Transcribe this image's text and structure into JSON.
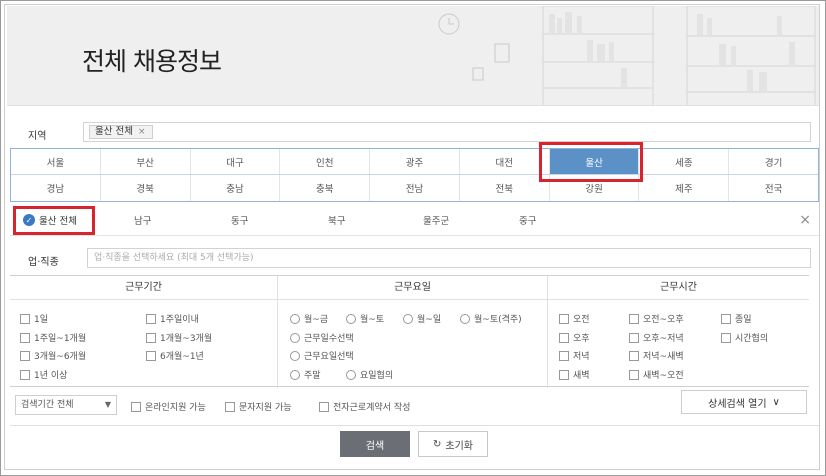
{
  "header": {
    "title": "전체 채용정보"
  },
  "region": {
    "label": "지역",
    "selected_tag": "울산 전체",
    "tag_remove": "×",
    "row1": [
      "서울",
      "부산",
      "대구",
      "인천",
      "광주",
      "대전",
      "울산",
      "세종",
      "경기"
    ],
    "row2": [
      "경남",
      "경북",
      "충남",
      "충북",
      "전남",
      "전북",
      "강원",
      "제주",
      "전국"
    ],
    "active": "울산"
  },
  "district": {
    "all_label": "울산 전체",
    "check_glyph": "✓",
    "items": [
      "남구",
      "동구",
      "북구",
      "울주군",
      "중구"
    ],
    "close_glyph": "×"
  },
  "job": {
    "label": "업·직종",
    "placeholder": "업·직종을 선택하세요 (최대 5개 선택가능)"
  },
  "filters": {
    "period": {
      "title": "근무기간",
      "options": [
        "1일",
        "1주일이내",
        "1주일~1개월",
        "1개월~3개월",
        "3개월~6개월",
        "6개월~1년",
        "1년 이상"
      ]
    },
    "days": {
      "title": "근무요일",
      "options": [
        "월~금",
        "월~토",
        "월~일",
        "월~토(격주)",
        "근무일수선택",
        "근무요일선택",
        "주말",
        "요일협의"
      ]
    },
    "hours": {
      "title": "근무시간",
      "options": [
        "오전",
        "오전~오후",
        "종일",
        "오후",
        "오후~저녁",
        "시간협의",
        "저녁",
        "저녁~새벽",
        "새벽",
        "새벽~오전"
      ]
    }
  },
  "bottom": {
    "period_select": "검색기간 전체",
    "select_arrow": "▼",
    "checks": [
      "온라인지원 가능",
      "문자지원 가능",
      "전자근로계약서 작성"
    ],
    "detail_label": "상세검색 열기",
    "detail_arrow": "∨"
  },
  "actions": {
    "search": "검색",
    "reset": "초기화",
    "reset_icon": "↻"
  },
  "colors": {
    "active_cell": "#5b91c7",
    "highlight": "#d9232d",
    "search_button": "#6b6f75"
  }
}
